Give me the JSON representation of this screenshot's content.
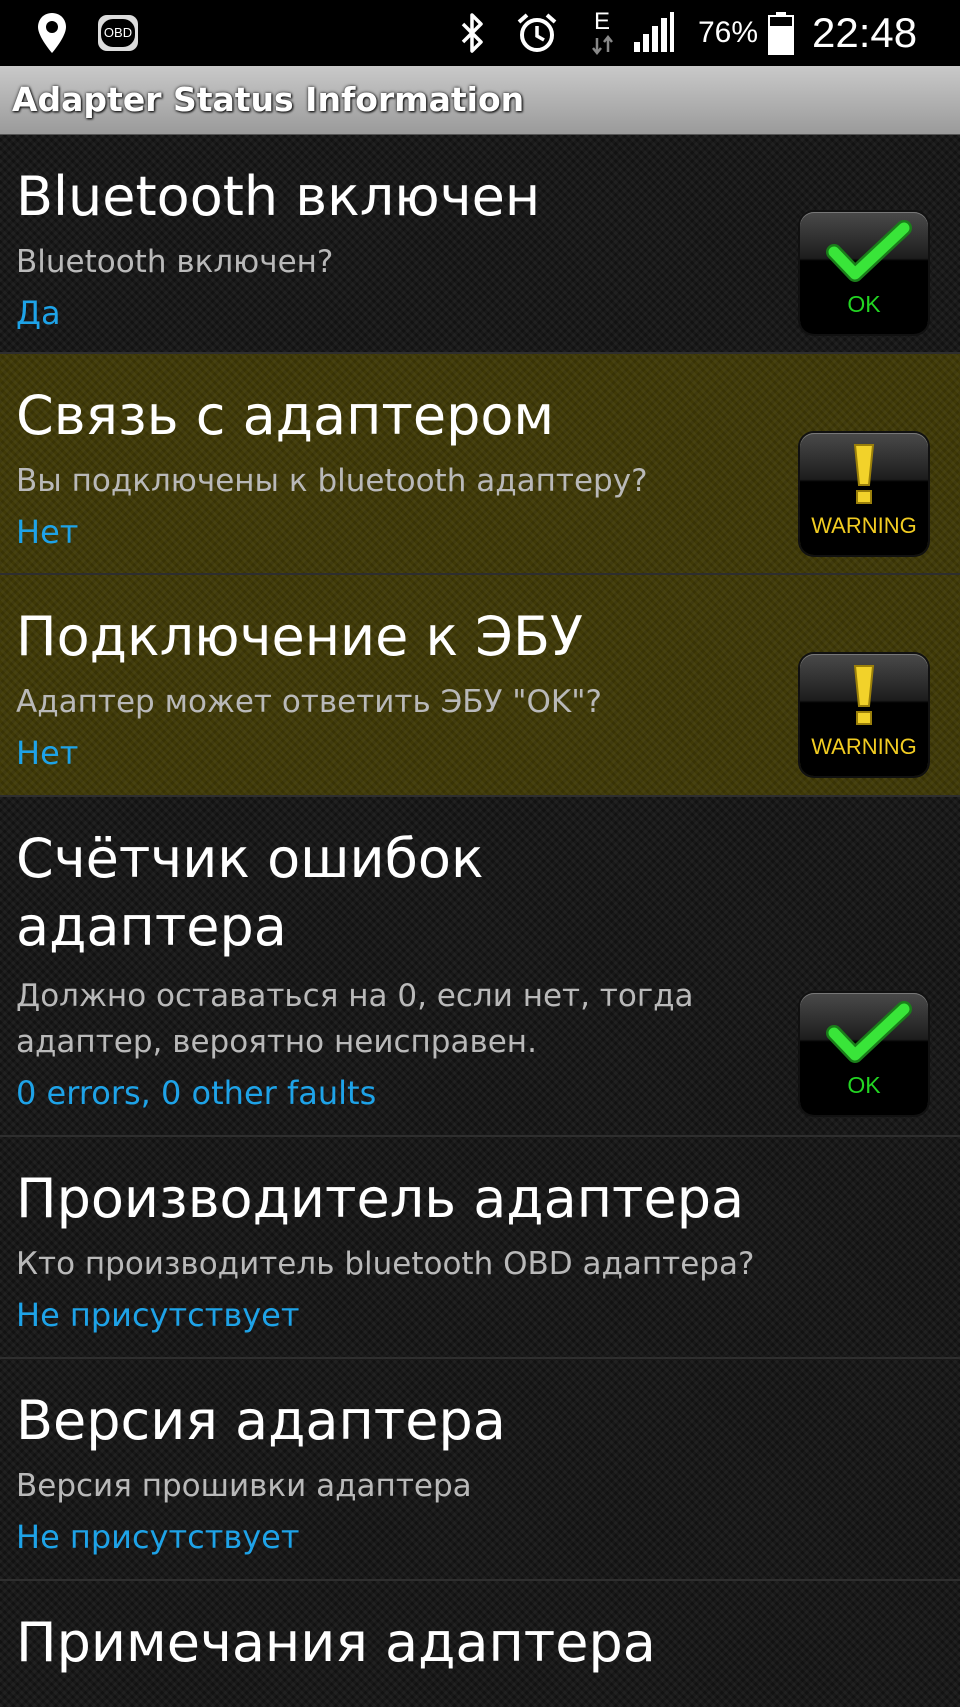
{
  "status_bar": {
    "icons": [
      "location-icon",
      "obd-icon",
      "bluetooth-icon",
      "alarm-icon",
      "edge-data-icon",
      "signal-icon",
      "battery-icon"
    ],
    "obd_label": "OBD",
    "network_label": "E",
    "battery_percent": "76%",
    "battery_level": 0.76,
    "time": "22:48"
  },
  "title_bar": {
    "title": "Adapter Status Information"
  },
  "colors": {
    "value_text": "#1ea3e8",
    "warning_row": "#403a07",
    "ok_label": "#22d422",
    "warning_label": "#f1cc22"
  },
  "items": [
    {
      "title": "Bluetooth включен",
      "subtitle": "Bluetooth включен?",
      "value": "Да",
      "status": "ok",
      "badge_label": "OK"
    },
    {
      "title": "Связь с адаптером",
      "subtitle": "Вы подключены к bluetooth адаптеру?",
      "value": "Нет",
      "status": "warning",
      "badge_label": "WARNING"
    },
    {
      "title": "Подключение к ЭБУ",
      "subtitle": "Адаптер может ответить ЭБУ \"OK\"?",
      "value": "Нет",
      "status": "warning",
      "badge_label": "WARNING"
    },
    {
      "title": "Счётчик ошибок адаптера",
      "subtitle": "Должно оставаться на 0, если нет, тогда адаптер, вероятно неисправен.",
      "value": "0 errors, 0 other faults",
      "status": "ok",
      "badge_label": "OK"
    },
    {
      "title": "Производитель адаптера",
      "subtitle": "Кто производитель bluetooth OBD адаптера?",
      "value": "Не присутствует",
      "status": "none"
    },
    {
      "title": "Версия адаптера",
      "subtitle": "Версия прошивки адаптера",
      "value": "Не присутствует",
      "status": "none"
    },
    {
      "title": "Примечания адаптера",
      "status": "none"
    }
  ]
}
